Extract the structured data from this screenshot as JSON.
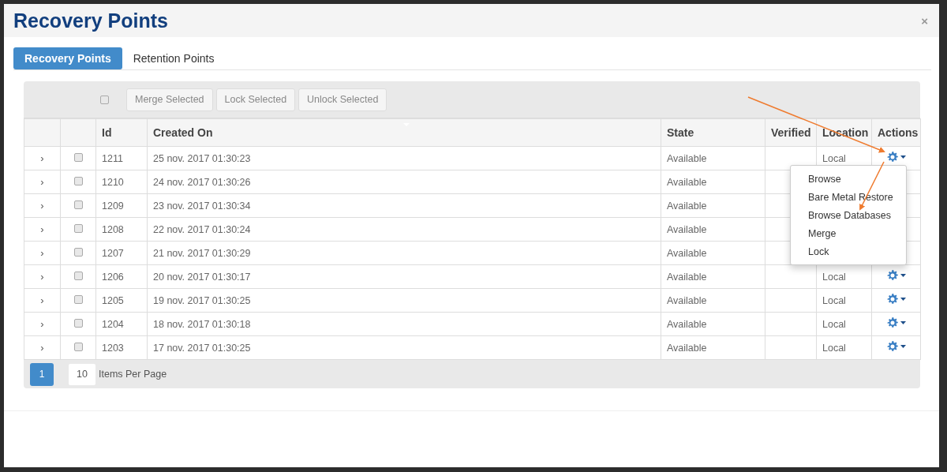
{
  "window": {
    "title": "Recovery Points",
    "close": "×"
  },
  "tabs": [
    {
      "label": "Recovery Points",
      "selected": true
    },
    {
      "label": "Retention Points",
      "selected": false
    }
  ],
  "toolbar": {
    "select_all": {
      "checked": false
    },
    "buttons": [
      {
        "label": "Merge Selected",
        "disabled": true
      },
      {
        "label": "Lock Selected",
        "disabled": true
      },
      {
        "label": "Unlock Selected",
        "disabled": true
      }
    ]
  },
  "table": {
    "columns": [
      "Id",
      "Created On",
      "State",
      "Verified",
      "Location",
      "Actions"
    ],
    "rows": [
      {
        "expander": "›",
        "id": "1211",
        "created": "25 nov. 2017 01:30:23",
        "state": "Available",
        "location": "Local",
        "checked": false,
        "actions_menu": [
          "Browse",
          "Bare Metal Restore",
          "Browse Databases",
          "Merge",
          "Lock"
        ]
      },
      {
        "expander": "›",
        "id": "1210",
        "created": "24 nov. 2017 01:30:26",
        "state": "Available",
        "checked": false
      },
      {
        "expander": "›",
        "id": "1209",
        "created": "23 nov. 2017 01:30:34",
        "state": "Available",
        "checked": false
      },
      {
        "expander": "›",
        "id": "1208",
        "created": "22 nov. 2017 01:30:24",
        "state": "Available",
        "checked": false
      },
      {
        "expander": "›",
        "id": "1207",
        "created": "21 nov. 2017 01:30:29",
        "state": "Available",
        "checked": false
      },
      {
        "expander": "›",
        "id": "1206",
        "created": "20 nov. 2017 01:30:17",
        "state": "Available",
        "location": "Local",
        "checked": false
      },
      {
        "expander": "›",
        "id": "1205",
        "created": "19 nov. 2017 01:30:25",
        "state": "Available",
        "location": "Local",
        "checked": false
      },
      {
        "expander": "›",
        "id": "1204",
        "created": "18 nov. 2017 01:30:18",
        "state": "Available",
        "location": "Local",
        "checked": false
      },
      {
        "expander": "›",
        "id": "1203",
        "created": "17 nov. 2017 01:30:25",
        "state": "Available",
        "location": "Local",
        "checked": false
      }
    ]
  },
  "pager": {
    "pages": [
      {
        "label": "1",
        "selected": true
      }
    ],
    "page_size": "10",
    "page_size_label": "Items Per Page"
  }
}
